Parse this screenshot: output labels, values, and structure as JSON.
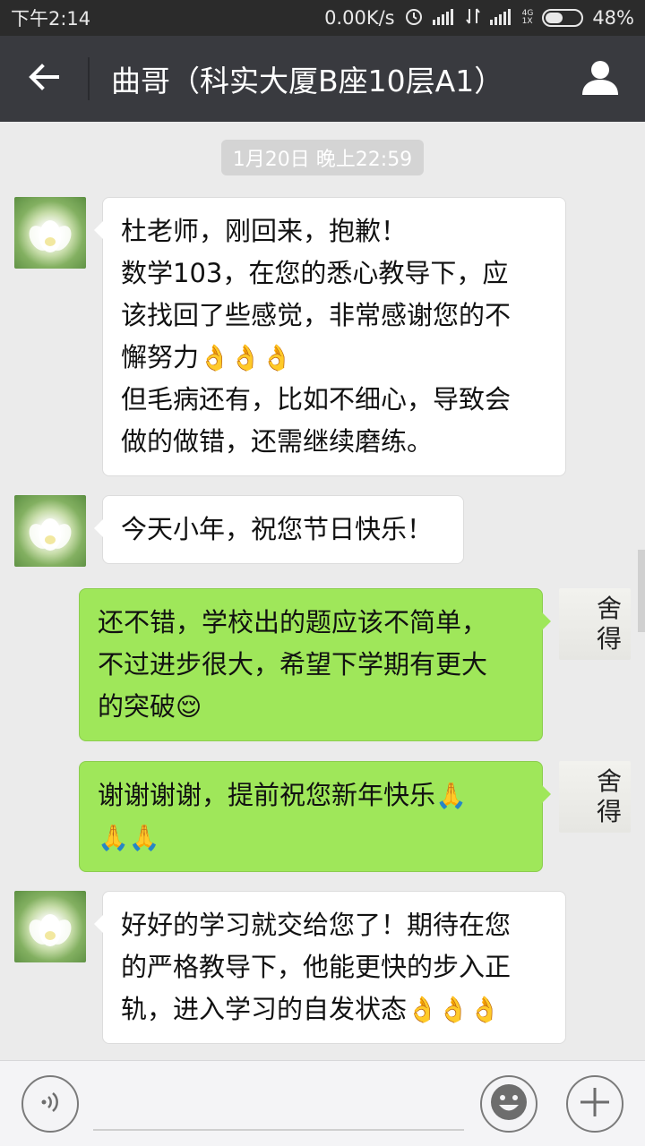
{
  "status_bar": {
    "time": "下午2:14",
    "speed": "0.00K/s",
    "net_top": "4G",
    "net_bottom": "1X",
    "battery": "48%",
    "battery_level": 0.48
  },
  "header": {
    "back_icon": "arrow-left-icon",
    "title": "曲哥（科实大厦B座10层A1）",
    "profile_icon": "person-icon"
  },
  "chat": {
    "timestamp": "1月20日 晚上22:59",
    "messages": [
      {
        "direction": "incoming",
        "avatar": "lotus-avatar",
        "lines": [
          "杜老师，刚回来，抱歉！",
          "数学103，在您的悉心教导下，应",
          "该找回了些感觉，非常感谢您的不",
          "懈努力",
          "但毛病还有，比如不细心，导致会",
          "做的做错，还需继续磨练。"
        ],
        "emoji": "👌👌👌"
      },
      {
        "direction": "incoming",
        "avatar": "lotus-avatar",
        "lines": [
          "今天小年，祝您节日快乐！"
        ]
      },
      {
        "direction": "outgoing",
        "avatar": "calligraphy-avatar",
        "avatar_text": [
          "舍",
          "得"
        ],
        "lines": [
          "还不错，学校出的题应该不简单，",
          "不过进步很大，希望下学期有更大",
          "的突破"
        ],
        "emoji": "😌"
      },
      {
        "direction": "outgoing",
        "avatar": "calligraphy-avatar",
        "avatar_text": [
          "舍",
          "得"
        ],
        "lines": [
          "谢谢谢谢，提前祝您新年快乐"
        ],
        "emoji": "🙏",
        "emoji2": "🙏🙏"
      },
      {
        "direction": "incoming",
        "avatar": "lotus-avatar",
        "lines": [
          "好好的学习就交给您了！期待在您",
          "的严格教导下，他能更快的步入正",
          "轨，进入学习的自发状态"
        ],
        "emoji": "👌👌👌"
      }
    ]
  },
  "input_bar": {
    "voice_icon": "voice-icon",
    "emoji_icon": "smiley-icon",
    "plus_icon": "plus-icon",
    "placeholder": ""
  }
}
